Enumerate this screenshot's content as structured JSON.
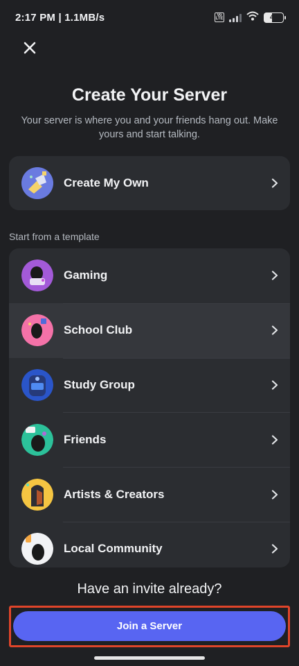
{
  "status_bar": {
    "time_speed": "2:17 PM | 1.1MB/s",
    "battery": "41"
  },
  "header": {
    "title": "Create Your Server",
    "subtitle": "Your server is where you and your friends hang out. Make yours and start talking."
  },
  "create_own": {
    "label": "Create My Own",
    "icon": "create-server-icon"
  },
  "templates": {
    "section_label": "Start from a template",
    "items": [
      {
        "label": "Gaming",
        "icon": "gaming-icon",
        "color": "#9b59d6"
      },
      {
        "label": "School Club",
        "icon": "school-club-icon",
        "color": "#f26b9e"
      },
      {
        "label": "Study Group",
        "icon": "study-group-icon",
        "color": "#2f63d6"
      },
      {
        "label": "Friends",
        "icon": "friends-icon",
        "color": "#2bb59a"
      },
      {
        "label": "Artists & Creators",
        "icon": "artists-icon",
        "color": "#f5c542"
      },
      {
        "label": "Local Community",
        "icon": "local-community-icon",
        "color": "#eeeeee"
      }
    ]
  },
  "footer": {
    "invite_title": "Have an invite already?",
    "join_label": "Join a Server"
  },
  "colors": {
    "accent": "#5865f2",
    "highlight": "#e0452a",
    "background": "#1f2023",
    "card": "#2b2d31"
  }
}
